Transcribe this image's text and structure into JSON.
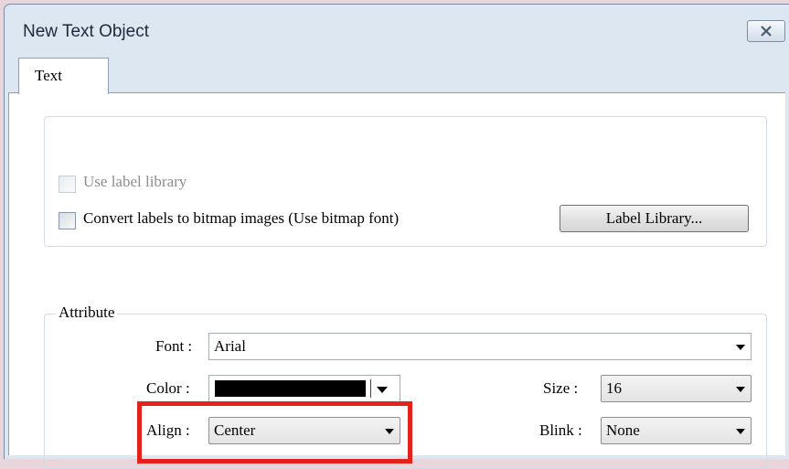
{
  "window": {
    "title": "New  Text Object"
  },
  "tabs": [
    {
      "label": "Text"
    }
  ],
  "label_settings": {
    "use_label_library": {
      "label": "Use label library",
      "checked": false,
      "enabled": false
    },
    "convert_labels": {
      "label": "Convert labels to bitmap images (Use bitmap font)",
      "checked": false,
      "enabled": true
    },
    "label_library_button": "Label Library..."
  },
  "attribute": {
    "group_title": "Attribute",
    "font": {
      "label": "Font :",
      "value": "Arial"
    },
    "color": {
      "label": "Color :",
      "value": "#000000"
    },
    "size": {
      "label": "Size :",
      "value": "16"
    },
    "align": {
      "label": "Align :",
      "value": "Center"
    },
    "blink": {
      "label": "Blink :",
      "value": "None"
    }
  },
  "highlight_color": "#e5211c"
}
